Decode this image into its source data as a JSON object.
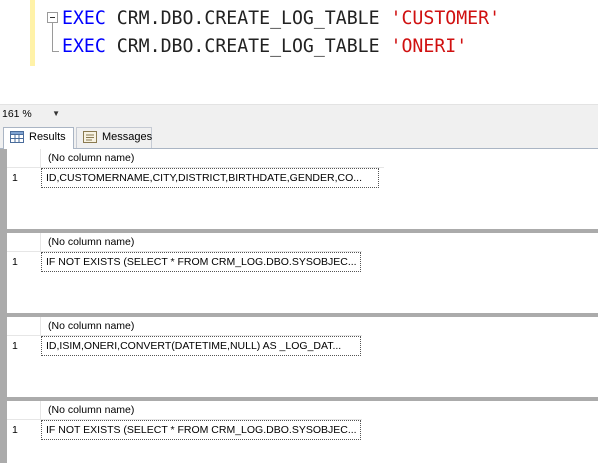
{
  "editor": {
    "line1": {
      "keyword": "EXEC",
      "procedure": "CRM.DBO.CREATE_LOG_TABLE",
      "argument": "'CUSTOMER'"
    },
    "line2": {
      "keyword": "EXEC",
      "procedure": "CRM.DBO.CREATE_LOG_TABLE",
      "argument": "'ONERI'"
    }
  },
  "zoom": {
    "value": "161 %"
  },
  "tabs": {
    "results": "Results",
    "messages": "Messages"
  },
  "grids": [
    {
      "header": "(No column name)",
      "row": "1",
      "value": "ID,CUSTOMERNAME,CITY,DISTRICT,BIRTHDATE,GENDER,CO..."
    },
    {
      "header": "(No column name)",
      "row": "1",
      "value": "IF NOT EXISTS (SELECT * FROM CRM_LOG.DBO.SYSOBJEC..."
    },
    {
      "header": "(No column name)",
      "row": "1",
      "value": "ID,ISIM,ONERI,CONVERT(DATETIME,NULL) AS _LOG_DAT..."
    },
    {
      "header": "(No column name)",
      "row": "1",
      "value": "IF NOT EXISTS (SELECT * FROM CRM_LOG.DBO.SYSOBJEC..."
    }
  ]
}
